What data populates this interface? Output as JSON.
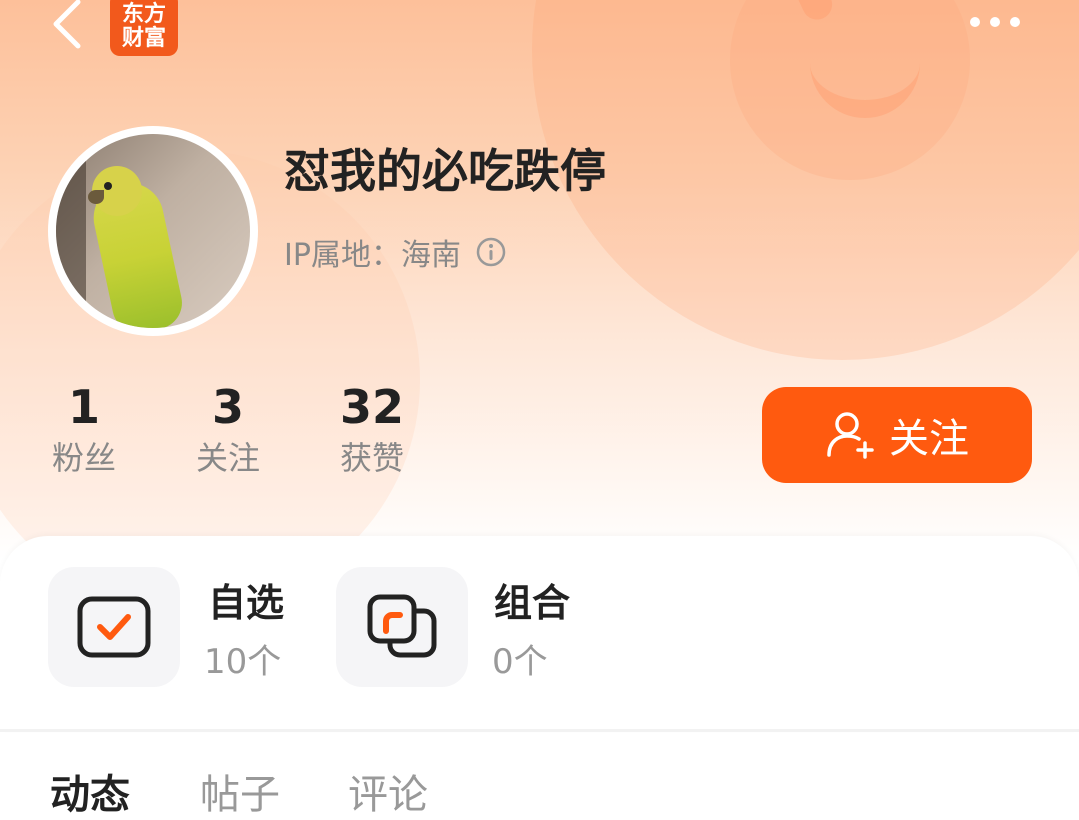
{
  "header": {
    "logo_line1": "东方",
    "logo_line2": "财富"
  },
  "profile": {
    "username": "怼我的必吃跌停",
    "ip_label": "IP属地：海南"
  },
  "stats": [
    {
      "value": "1",
      "label": "粉丝"
    },
    {
      "value": "3",
      "label": "关注"
    },
    {
      "value": "32",
      "label": "获赞"
    }
  ],
  "follow_button": {
    "label": "关注"
  },
  "entries": {
    "watchlist": {
      "title": "自选",
      "count": "10个"
    },
    "portfolio": {
      "title": "组合",
      "count": "0个"
    }
  },
  "tabs": [
    "动态",
    "帖子",
    "评论"
  ],
  "colors": {
    "accent": "#ff5a0f",
    "logo": "#f2591c"
  }
}
